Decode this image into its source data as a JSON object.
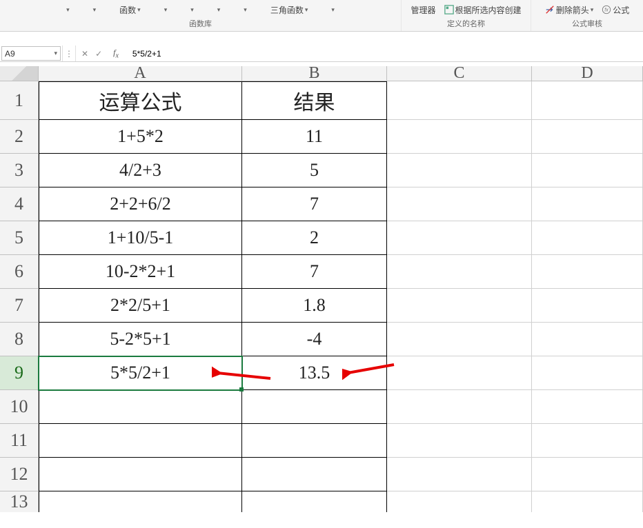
{
  "ribbon": {
    "group1": {
      "function_btn": "函数",
      "lib_label": "函数库",
      "trig_btn": "三角函数"
    },
    "group2": {
      "manager": "管理器",
      "create_from_sel": "根据所选内容创建",
      "label": "定义的名称"
    },
    "group3": {
      "remove_arrows": "删除箭头",
      "formula_short": "公式",
      "label": "公式审核"
    }
  },
  "namebox": "A9",
  "formula": "5*5/2+1",
  "cols": [
    "A",
    "B",
    "C",
    "D"
  ],
  "rows": [
    "1",
    "2",
    "3",
    "4",
    "5",
    "6",
    "7",
    "8",
    "9",
    "10",
    "11",
    "12",
    "13"
  ],
  "cells": {
    "A1": "运算公式",
    "B1": "结果",
    "A2": "1+5*2",
    "B2": "11",
    "A3": "4/2+3",
    "B3": "5",
    "A4": "2+2+6/2",
    "B4": "7",
    "A5": "1+10/5-1",
    "B5": "2",
    "A6": "10-2*2+1",
    "B6": "7",
    "A7": "2*2/5+1",
    "B7": "1.8",
    "A8": "5-2*5+1",
    "B8": "-4",
    "A9": "5*5/2+1",
    "B9": "13.5"
  },
  "chart_data": {
    "type": "table",
    "columns": [
      "运算公式",
      "结果"
    ],
    "rows": [
      [
        "1+5*2",
        11
      ],
      [
        "4/2+3",
        5
      ],
      [
        "2+2+6/2",
        7
      ],
      [
        "1+10/5-1",
        2
      ],
      [
        "10-2*2+1",
        7
      ],
      [
        "2*2/5+1",
        1.8
      ],
      [
        "5-2*5+1",
        -4
      ],
      [
        "5*5/2+1",
        13.5
      ]
    ],
    "highlighted_row_index": 7
  },
  "arrow_color": "#e60000"
}
